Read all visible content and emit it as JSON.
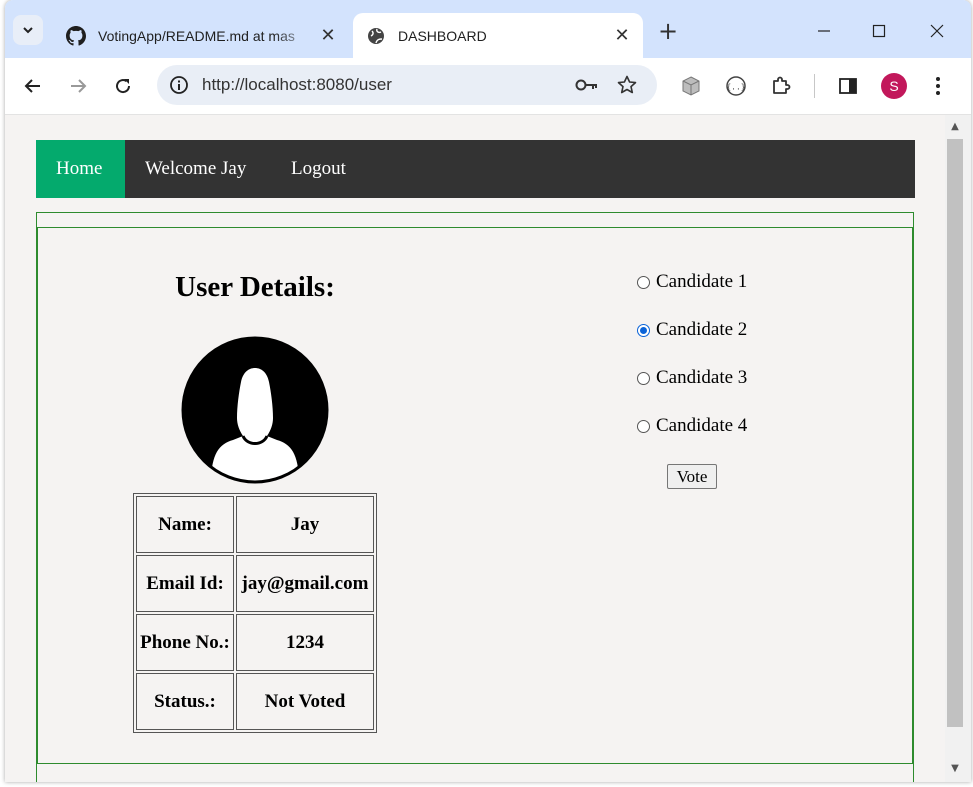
{
  "browser": {
    "tabs": [
      {
        "title": "VotingApp/README.md at mas",
        "icon": "github-icon",
        "active": false
      },
      {
        "title": "DASHBOARD",
        "icon": "globe-icon",
        "active": true
      }
    ],
    "address_bar": {
      "url": "http://localhost:8080/user"
    },
    "profile_initial": "S"
  },
  "navbar": {
    "home": "Home",
    "welcome": "Welcome Jay",
    "logout": "Logout"
  },
  "user_details": {
    "title": "User Details:",
    "rows": [
      {
        "label": "Name:",
        "value": "Jay"
      },
      {
        "label": "Email Id:",
        "value": "jay@gmail.com"
      },
      {
        "label": "Phone No.:",
        "value": "1234"
      },
      {
        "label": "Status.:",
        "value": "Not Voted"
      }
    ]
  },
  "vote": {
    "candidates": [
      {
        "label": "Candidate 1",
        "checked": false
      },
      {
        "label": "Candidate 2",
        "checked": true
      },
      {
        "label": "Candidate 3",
        "checked": false
      },
      {
        "label": "Candidate 4",
        "checked": false
      }
    ],
    "button": "Vote"
  },
  "colors": {
    "nav_bg": "#333333",
    "home_active": "#04aa6d",
    "box_border": "#2e8b2e",
    "page_bg": "#f5f3f2",
    "radio_accent": "#0b63d8"
  }
}
